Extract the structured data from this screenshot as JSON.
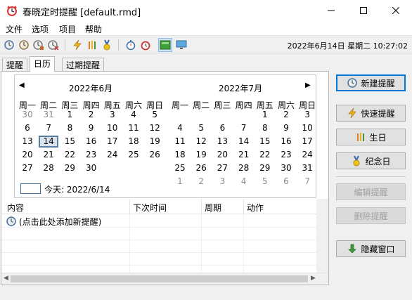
{
  "window": {
    "title": "春晓定时提醒 [default.rmd]",
    "controls": [
      "minimize",
      "maximize",
      "close"
    ]
  },
  "menu": [
    "文件",
    "选项",
    "项目",
    "帮助"
  ],
  "toolbar": {
    "icons": [
      "new-reminder-icon",
      "clock-icon",
      "clock-edit-icon",
      "clock-delete-icon",
      "lightning-icon",
      "pencils-icon",
      "medal-icon",
      "stopwatch-icon",
      "alarm-icon",
      "green-panel-icon",
      "monitor-icon"
    ],
    "clock": "2022年6月14日 星期二 10:27:02"
  },
  "tabs": [
    "提醒",
    "日历",
    "过期提醒"
  ],
  "calendar": {
    "prev_arrow": "◀",
    "next_arrow": "▶",
    "weekdays": [
      "周一",
      "周二",
      "周三",
      "周四",
      "周五",
      "周六",
      "周日"
    ],
    "months": [
      {
        "title": "2022年6月",
        "rows": [
          [
            {
              "d": "30",
              "o": true
            },
            {
              "d": "31",
              "o": true
            },
            {
              "d": "1"
            },
            {
              "d": "2"
            },
            {
              "d": "3"
            },
            {
              "d": "4"
            },
            {
              "d": "5"
            }
          ],
          [
            {
              "d": "6"
            },
            {
              "d": "7"
            },
            {
              "d": "8"
            },
            {
              "d": "9"
            },
            {
              "d": "10"
            },
            {
              "d": "11"
            },
            {
              "d": "12"
            }
          ],
          [
            {
              "d": "13"
            },
            {
              "d": "14",
              "t": true
            },
            {
              "d": "15"
            },
            {
              "d": "16"
            },
            {
              "d": "17"
            },
            {
              "d": "18"
            },
            {
              "d": "19"
            }
          ],
          [
            {
              "d": "20"
            },
            {
              "d": "21"
            },
            {
              "d": "22"
            },
            {
              "d": "23"
            },
            {
              "d": "24"
            },
            {
              "d": "25"
            },
            {
              "d": "26"
            }
          ],
          [
            {
              "d": "27"
            },
            {
              "d": "28"
            },
            {
              "d": "29"
            },
            {
              "d": "30"
            },
            {
              "d": ""
            },
            {
              "d": ""
            },
            {
              "d": ""
            }
          ],
          [
            {
              "d": ""
            },
            {
              "d": ""
            },
            {
              "d": ""
            },
            {
              "d": ""
            },
            {
              "d": ""
            },
            {
              "d": ""
            },
            {
              "d": ""
            }
          ]
        ]
      },
      {
        "title": "2022年7月",
        "rows": [
          [
            {
              "d": ""
            },
            {
              "d": ""
            },
            {
              "d": ""
            },
            {
              "d": ""
            },
            {
              "d": "1"
            },
            {
              "d": "2"
            },
            {
              "d": "3"
            }
          ],
          [
            {
              "d": "4"
            },
            {
              "d": "5"
            },
            {
              "d": "6"
            },
            {
              "d": "7"
            },
            {
              "d": "8"
            },
            {
              "d": "9"
            },
            {
              "d": "10"
            }
          ],
          [
            {
              "d": "11"
            },
            {
              "d": "12"
            },
            {
              "d": "13"
            },
            {
              "d": "14"
            },
            {
              "d": "15"
            },
            {
              "d": "16"
            },
            {
              "d": "17"
            }
          ],
          [
            {
              "d": "18"
            },
            {
              "d": "19"
            },
            {
              "d": "20"
            },
            {
              "d": "21"
            },
            {
              "d": "22"
            },
            {
              "d": "23"
            },
            {
              "d": "24"
            }
          ],
          [
            {
              "d": "25"
            },
            {
              "d": "26"
            },
            {
              "d": "27"
            },
            {
              "d": "28"
            },
            {
              "d": "29"
            },
            {
              "d": "30"
            },
            {
              "d": "31"
            }
          ],
          [
            {
              "d": "1",
              "o": true
            },
            {
              "d": "2",
              "o": true
            },
            {
              "d": "3",
              "o": true
            },
            {
              "d": "4",
              "o": true
            },
            {
              "d": "5",
              "o": true
            },
            {
              "d": "6",
              "o": true
            },
            {
              "d": "7",
              "o": true
            }
          ]
        ]
      }
    ],
    "today_label": "今天: 2022/6/14"
  },
  "list": {
    "columns": [
      "内容",
      "下次时间",
      "周期",
      "动作"
    ],
    "rows": [
      {
        "icon": "new-reminder-icon",
        "text": "(点击此处添加新提醒)"
      }
    ]
  },
  "buttons": {
    "new": "新建提醒",
    "quick": "快速提醒",
    "birthday": "生日",
    "anniversary": "纪念日",
    "edit": "编辑提醒",
    "delete": "删除提醒",
    "hide": "隐藏窗口"
  },
  "colors": {
    "today_border": "#5a7fa3",
    "primary_button_border": "#0078d7",
    "disabled_text": "#a0a0a0"
  }
}
